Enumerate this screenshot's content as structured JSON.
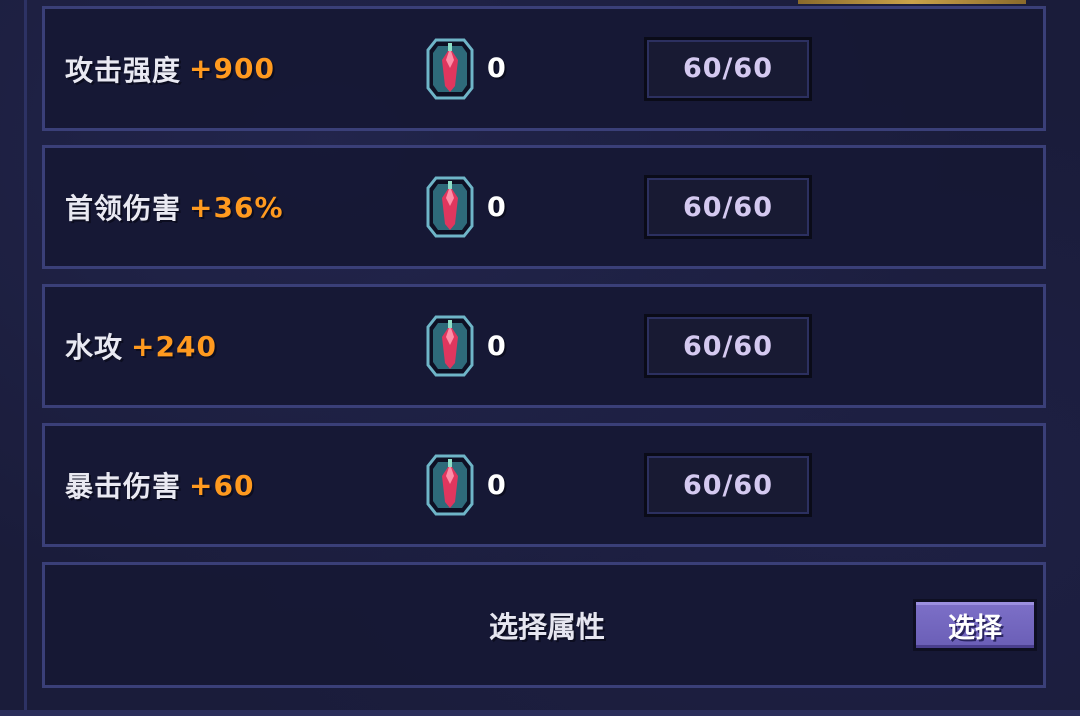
{
  "stats": [
    {
      "name": "攻击强度",
      "bonus": "+900",
      "gem_count": "0",
      "progress": "60/60"
    },
    {
      "name": "首领伤害",
      "bonus": "+36%",
      "gem_count": "0",
      "progress": "60/60"
    },
    {
      "name": "水攻",
      "bonus": "+240",
      "gem_count": "0",
      "progress": "60/60"
    },
    {
      "name": "暴击伤害",
      "bonus": "+60",
      "gem_count": "0",
      "progress": "60/60"
    }
  ],
  "select_panel": {
    "title": "选择属性",
    "button_label": "选择"
  },
  "icons": {
    "gem": "red-crystal-gem-icon"
  },
  "colors": {
    "bonus": "#ff9a1f",
    "panel_border": "#3a3f78",
    "button": "#7d70c8"
  }
}
